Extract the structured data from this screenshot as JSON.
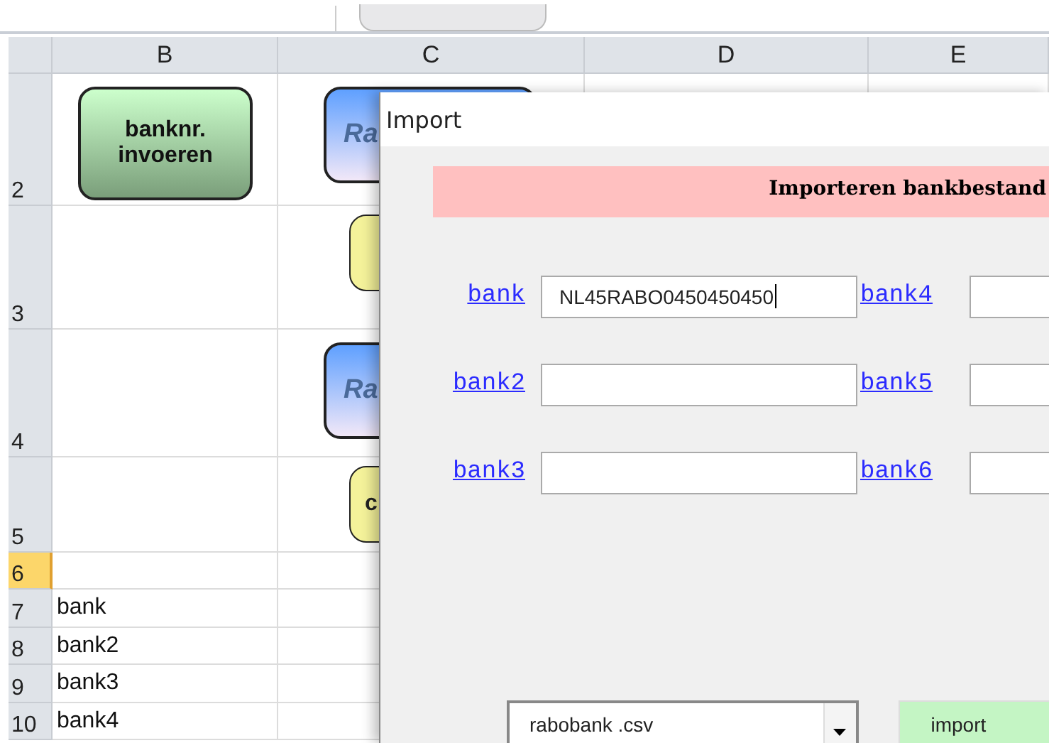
{
  "spreadsheet": {
    "columns": [
      "B",
      "C",
      "D",
      "E"
    ],
    "rows": [
      {
        "number": "2",
        "selected": false,
        "b_shape": {
          "kind": "green",
          "label": "banknr. invoeren"
        },
        "c_shape": {
          "kind": "blue",
          "label": "Ra"
        }
      },
      {
        "number": "3",
        "selected": false,
        "c_shape": {
          "kind": "yellow"
        }
      },
      {
        "number": "4",
        "selected": false,
        "c_shape": {
          "kind": "blue",
          "label": "Ra"
        }
      },
      {
        "number": "5",
        "selected": false,
        "c_shape": {
          "kind": "yellow",
          "label": "c"
        }
      },
      {
        "number": "6",
        "selected": true
      },
      {
        "number": "7",
        "selected": false,
        "b": "bank"
      },
      {
        "number": "8",
        "selected": false,
        "b": "bank2"
      },
      {
        "number": "9",
        "selected": false,
        "b": "bank3"
      },
      {
        "number": "10",
        "selected": false,
        "b": "bank4"
      }
    ]
  },
  "dialog": {
    "title": "Import",
    "banner": "Importeren bankbestand",
    "fields": [
      {
        "label": "bank",
        "value": "NL45RABO0450450450"
      },
      {
        "label": "bank2"
      },
      {
        "label": "bank3"
      },
      {
        "label": "bank4"
      },
      {
        "label": "bank5"
      },
      {
        "label": "bank6"
      }
    ],
    "file_select": {
      "value": "rabobank .csv"
    },
    "import_button": "import"
  }
}
